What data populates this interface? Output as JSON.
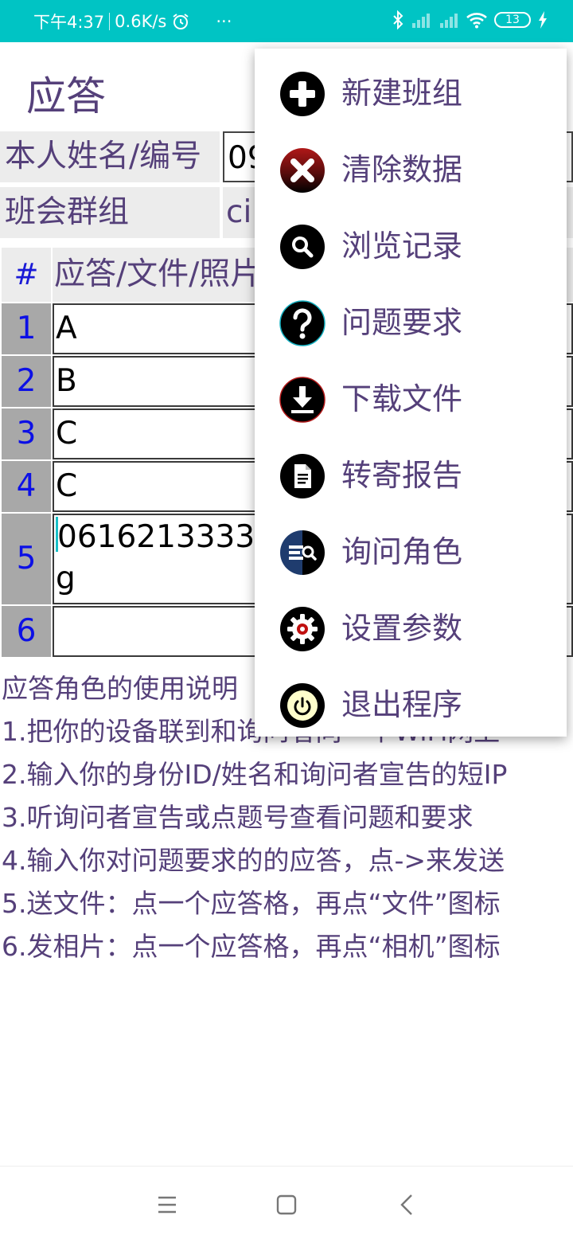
{
  "status_bar": {
    "time": "下午4:37",
    "speed": "0.6K/s",
    "more": "···",
    "battery": "13"
  },
  "app": {
    "title": "应答"
  },
  "info": {
    "name_label": "本人姓名/编号",
    "name_value": "09",
    "group_label": "班会群组",
    "group_value": "ci."
  },
  "table": {
    "hash": "#",
    "header": "应答/文件/照片",
    "rows": [
      {
        "num": "1",
        "value": "A"
      },
      {
        "num": "2",
        "value": "B"
      },
      {
        "num": "3",
        "value": "C"
      },
      {
        "num": "4",
        "value": "C"
      },
      {
        "num": "5",
        "value": "0616213333.",
        "value_line2": "g"
      },
      {
        "num": "6",
        "value": ""
      }
    ]
  },
  "help": {
    "title": "应答角色的使用说明",
    "lines": [
      "1.把你的设备联到和询问者同一个WiFi网上",
      "2.输入你的身份ID/姓名和询问者宣告的短IP",
      "3.听询问者宣告或点题号查看问题和要求",
      "4.输入你对问题要求的的应答，点->来发送",
      "5.送文件：点一个应答格，再点“文件”图标",
      "6.发相片：点一个应答格，再点“相机”图标"
    ]
  },
  "menu": {
    "items": [
      {
        "label": "新建班组",
        "icon": "plus-icon"
      },
      {
        "label": "清除数据",
        "icon": "close-icon"
      },
      {
        "label": "浏览记录",
        "icon": "search-icon"
      },
      {
        "label": "问题要求",
        "icon": "question-icon"
      },
      {
        "label": "下载文件",
        "icon": "download-icon"
      },
      {
        "label": "转寄报告",
        "icon": "document-icon"
      },
      {
        "label": "询问角色",
        "icon": "list-search-icon"
      },
      {
        "label": "设置参数",
        "icon": "gear-icon"
      },
      {
        "label": "退出程序",
        "icon": "power-icon"
      }
    ]
  },
  "colors": {
    "status_bar": "#00c4c4",
    "text": "#55407a",
    "row_number": "#0c10e6"
  }
}
